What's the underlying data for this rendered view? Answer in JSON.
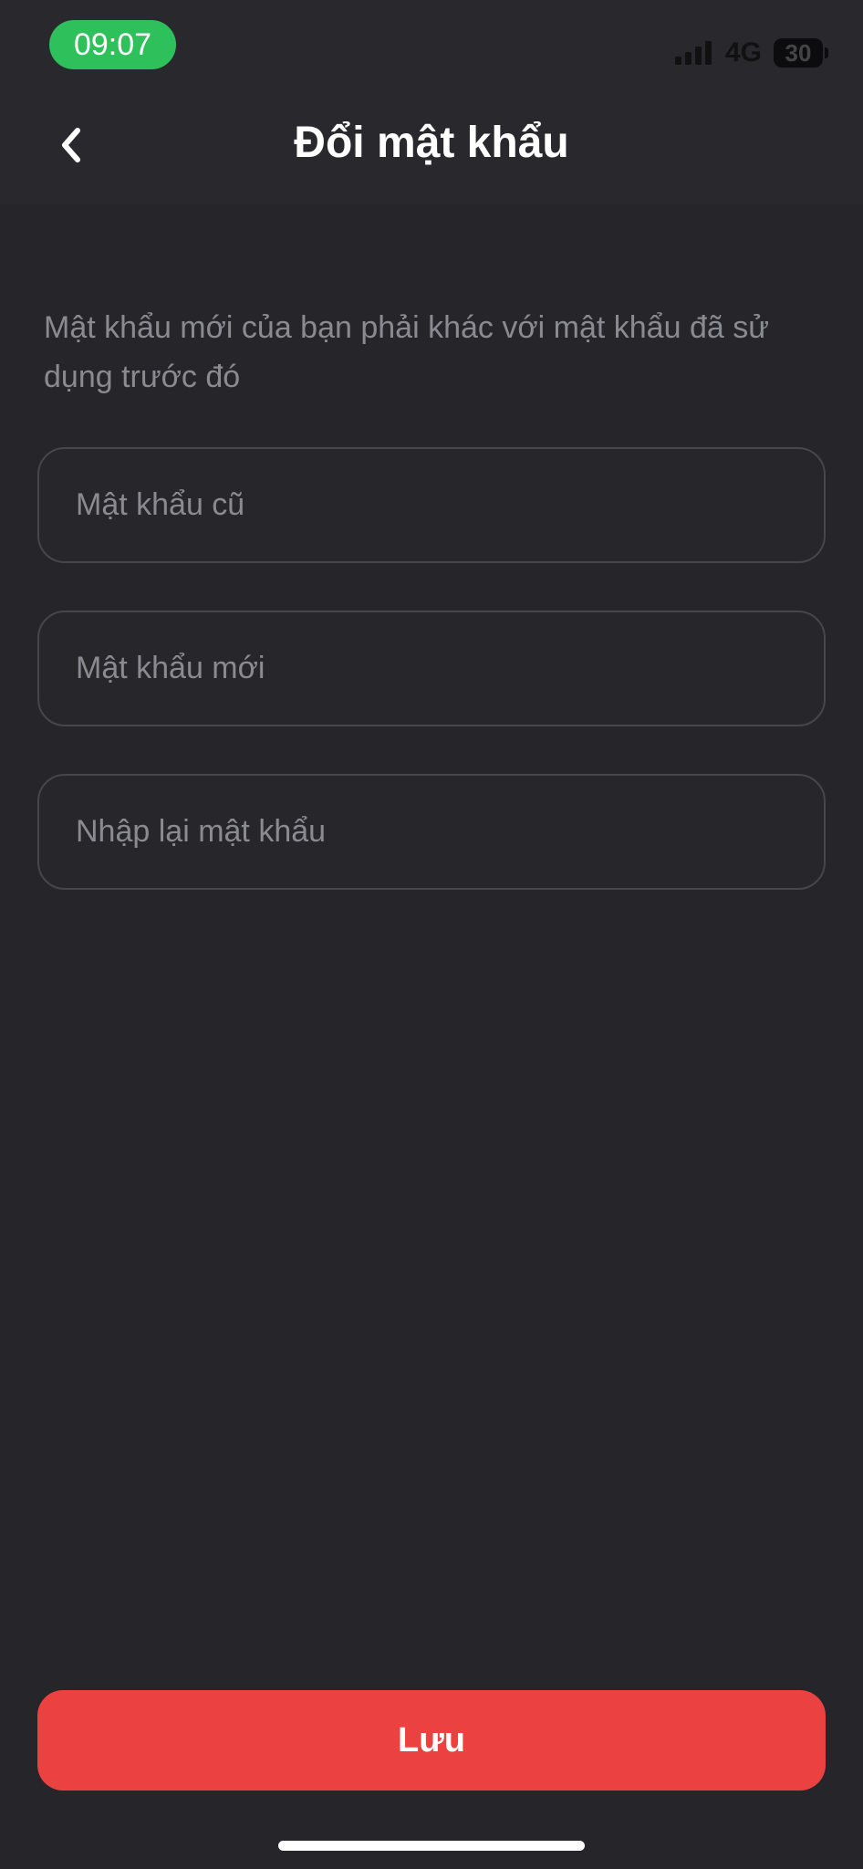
{
  "status_bar": {
    "time": "09:07",
    "network": "4G",
    "battery": "30",
    "time_pill_color": "#2ec05a",
    "signal_icon": "cellular-signal-icon",
    "battery_icon": "battery-icon"
  },
  "header": {
    "title": "Đổi mật khẩu",
    "back_icon": "chevron-left-icon"
  },
  "form": {
    "description": "Mật khẩu mới của bạn phải khác với mật khẩu đã sử dụng trước đó",
    "old_password": {
      "value": "",
      "placeholder": "Mật khẩu cũ"
    },
    "new_password": {
      "value": "",
      "placeholder": "Mật khẩu mới"
    },
    "confirm_password": {
      "value": "",
      "placeholder": "Nhập lại mật khẩu"
    }
  },
  "footer": {
    "save_label": "Lưu",
    "save_color": "#eb4141"
  }
}
